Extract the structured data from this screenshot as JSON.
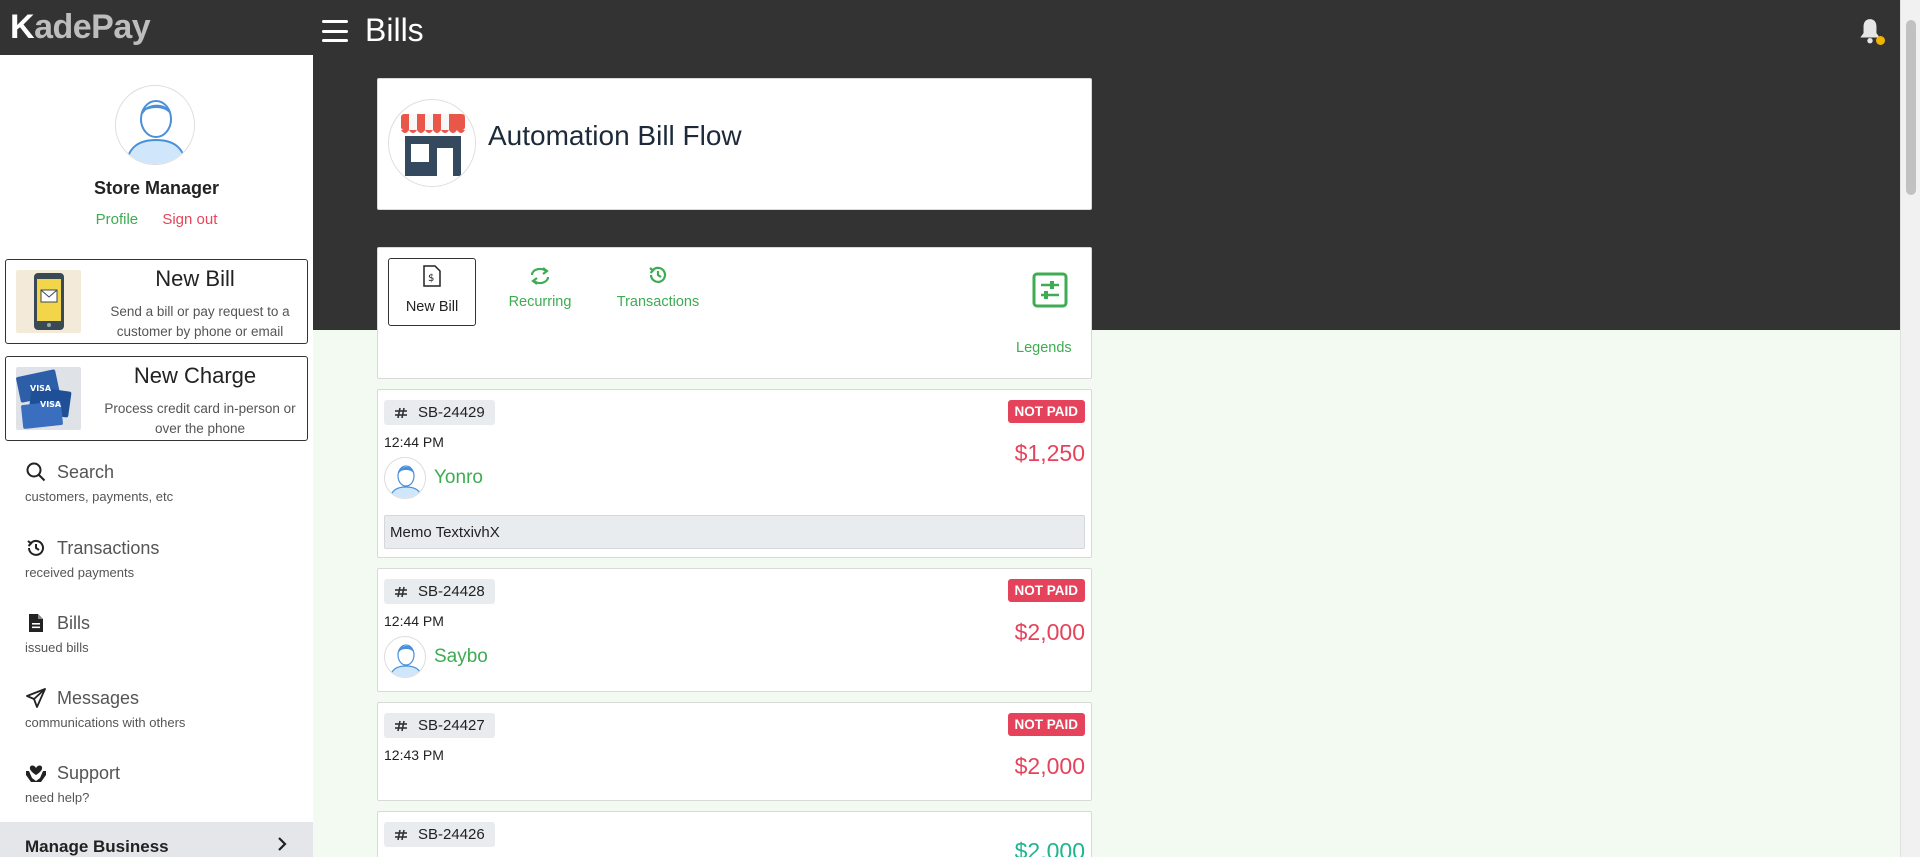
{
  "app": {
    "logo_k": "K",
    "logo_rest": "adePay",
    "page_title": "Bills"
  },
  "colors": {
    "header_bg": "#333333",
    "accent_green": "#3dac52",
    "danger_red": "#e5435b",
    "paid_teal": "#20b58d",
    "content_bg": "#f3faf2"
  },
  "user": {
    "name": "Store Manager",
    "profile_label": "Profile",
    "signout_label": "Sign out"
  },
  "sidebar": {
    "actions": [
      {
        "title": "New Bill",
        "desc": "Send a bill or pay request to a customer by phone or email",
        "icon": "phone-mail-icon"
      },
      {
        "title": "New Charge",
        "desc": "Process credit card in-person or over the phone",
        "icon": "credit-cards-icon"
      }
    ],
    "items": [
      {
        "label": "Search",
        "sub": "customers, payments, etc",
        "icon": "search-icon"
      },
      {
        "label": "Transactions",
        "sub": "received payments",
        "icon": "history-icon"
      },
      {
        "label": "Bills",
        "sub": "issued bills",
        "icon": "document-icon"
      },
      {
        "label": "Messages",
        "sub": "communications with others",
        "icon": "paper-plane-icon"
      },
      {
        "label": "Support",
        "sub": "need help?",
        "icon": "hands-heart-icon"
      }
    ],
    "manage_business": "Manage Business"
  },
  "merchant": {
    "name": "Automation Bill Flow"
  },
  "tabs": [
    {
      "label": "New Bill",
      "icon": "bill-doc-icon",
      "active": true
    },
    {
      "label": "Recurring",
      "icon": "repeat-icon",
      "active": false
    },
    {
      "label": "Transactions",
      "icon": "history-icon",
      "active": false
    }
  ],
  "legends_label": "Legends",
  "bills": [
    {
      "id": "SB-24429",
      "time": "12:44 PM",
      "status": "NOT PAID",
      "amount": "$1,250",
      "customer": "Yonro",
      "memo": "Memo TextxivhX"
    },
    {
      "id": "SB-24428",
      "time": "12:44 PM",
      "status": "NOT PAID",
      "amount": "$2,000",
      "customer": "Saybo"
    },
    {
      "id": "SB-24427",
      "time": "12:43 PM",
      "status": "NOT PAID",
      "amount": "$2,000"
    },
    {
      "id": "SB-24426",
      "amount": "$2,000"
    }
  ]
}
